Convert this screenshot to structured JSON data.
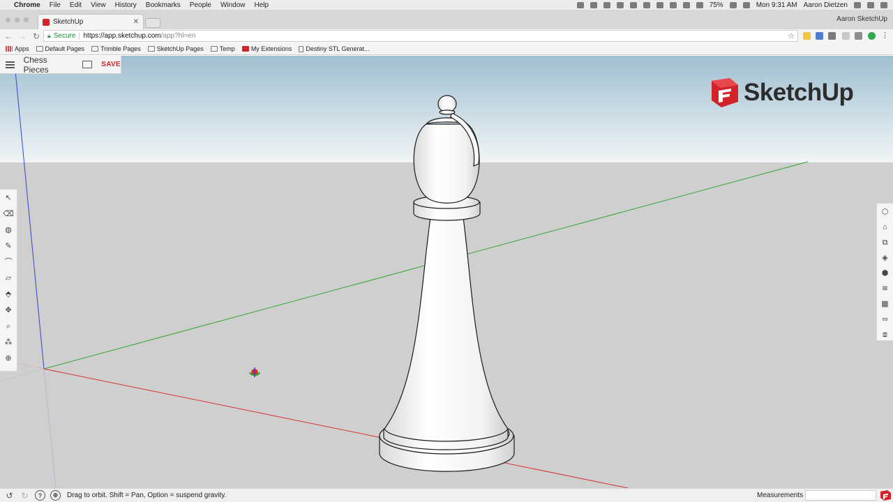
{
  "menubar": {
    "items": [
      "Chrome",
      "File",
      "Edit",
      "View",
      "History",
      "Bookmarks",
      "People",
      "Window",
      "Help"
    ],
    "battery": "75%",
    "clock": "Mon 9:31 AM",
    "user": "Aaron Dietzen"
  },
  "browser": {
    "tab_title": "SketchUp",
    "profile_name": "Aaron SketchUp",
    "secure_label": "Secure",
    "url_host": "https://app.sketchup.com",
    "url_path": "/app?hl=en"
  },
  "bookmarks": [
    "Apps",
    "Default Pages",
    "Trimble Pages",
    "SketchUp Pages",
    "Temp",
    "My Extensions",
    "Destiny STL Generat..."
  ],
  "app": {
    "model_name": "Chess Pieces",
    "save_label": "SAVE",
    "logo_text": "SketchUp"
  },
  "status": {
    "hint": "Drag to orbit. Shift = Pan, Option = suspend gravity.",
    "measurements_label": "Measurements",
    "measurements_value": ""
  },
  "colors": {
    "accent_red": "#d2232a",
    "sky_top": "#9fbfd0",
    "ground": "#cfcfcf",
    "axis_red": "#d73030",
    "axis_green": "#2ea82e",
    "axis_blue": "#3344cc"
  },
  "left_tools": [
    "select-icon",
    "eraser-icon",
    "paint-bucket-icon",
    "pencil-icon",
    "arc-icon",
    "rectangle-icon",
    "push-pull-icon",
    "move-icon",
    "tape-measure-icon",
    "walk-icon",
    "orbit-icon"
  ],
  "right_tools": [
    "entity-info-icon",
    "instructor-icon",
    "components-icon",
    "materials-icon",
    "styles-icon",
    "layers-icon",
    "scenes-icon",
    "display-icon",
    "model-info-icon"
  ]
}
